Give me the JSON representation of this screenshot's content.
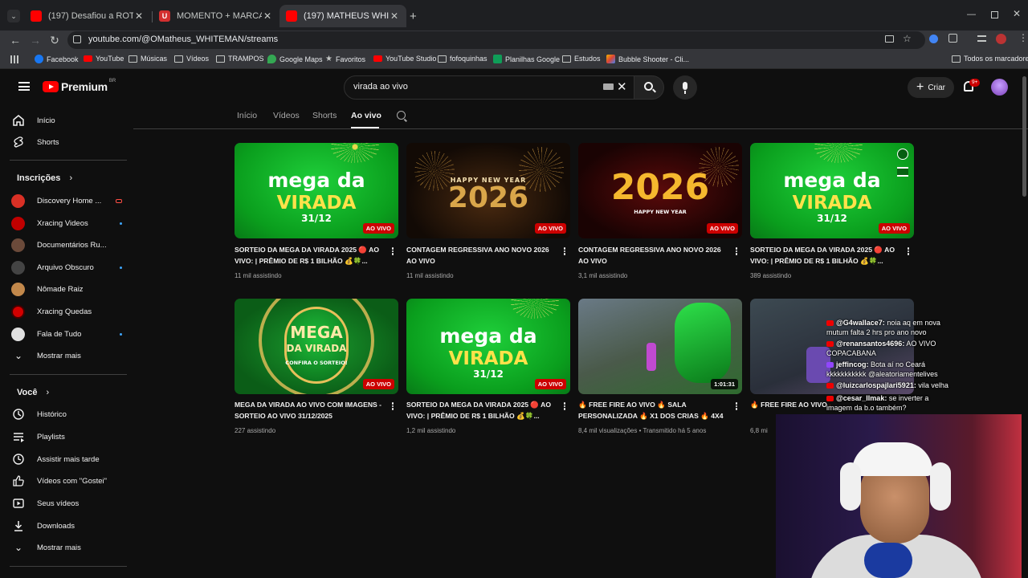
{
  "browser": {
    "tabs": [
      {
        "title": "(197) Desafiou a ROTA do PARÁ",
        "active": false
      },
      {
        "title": "MOMENTO + MARCANTE 2025",
        "active": false
      },
      {
        "title": "(197) MATHEUS WHITEMAN - Yo",
        "active": true
      }
    ],
    "url": "youtube.com/@OMatheus_WHITEMAN/streams",
    "bookmarks": [
      "Facebook",
      "YouTube",
      "Músicas",
      "Vídeos",
      "TRAMPOS",
      "Google Maps",
      "Favoritos",
      "YouTube Studio",
      "fofoquinhas",
      "Planilhas Google",
      "Estudos",
      "Bubble Shooter - Cli..."
    ],
    "all_bookmarks": "Todos os marcadores"
  },
  "header": {
    "logo": "Premium",
    "region": "BR",
    "search_value": "virada ao vivo",
    "create_label": "Criar",
    "notifications": "9+"
  },
  "sidebar": {
    "main": [
      {
        "label": "Início",
        "icon": "home-icon"
      },
      {
        "label": "Shorts",
        "icon": "shorts-icon"
      }
    ],
    "subscriptions_title": "Inscrições",
    "subscriptions": [
      {
        "label": "Discovery Home ...",
        "color": "#d93025",
        "indicator": "live"
      },
      {
        "label": "Xracing Videos",
        "color": "#c00000",
        "indicator": "dot"
      },
      {
        "label": "Documentários Ru...",
        "color": "#6b4a3a",
        "indicator": ""
      },
      {
        "label": "Arquivo Obscuro",
        "color": "#444444",
        "indicator": "dot"
      },
      {
        "label": "Nômade Raiz",
        "color": "#c2884b",
        "indicator": ""
      },
      {
        "label": "Xracing Quedas",
        "color": "#d20000",
        "indicator": ""
      },
      {
        "label": "Fala de Tudo",
        "color": "#e0e0e0",
        "indicator": "dot"
      }
    ],
    "show_more": "Mostrar mais",
    "you_title": "Você",
    "you_items": [
      {
        "label": "Histórico",
        "icon": "history-icon"
      },
      {
        "label": "Playlists",
        "icon": "playlists-icon"
      },
      {
        "label": "Assistir mais tarde",
        "icon": "watch-later-icon"
      },
      {
        "label": "Vídeos com \"Gostei\"",
        "icon": "like-icon"
      },
      {
        "label": "Seus vídeos",
        "icon": "your-videos-icon"
      },
      {
        "label": "Downloads",
        "icon": "download-icon"
      }
    ],
    "show_more_2": "Mostrar mais"
  },
  "channel_tabs": [
    "Início",
    "Vídeos",
    "Shorts",
    "Ao vivo"
  ],
  "videos": [
    {
      "title": "SORTEIO DA MEGA DA VIRADA 2025 🔴 AO VIVO: | PRÊMIO DE R$ 1 BILHÃO 💰🍀...",
      "meta": "11 mil assistindo",
      "badge": "AO VIVO",
      "thumb": "mega"
    },
    {
      "title": "CONTAGEM REGRESSIVA ANO NOVO 2026 AO VIVO",
      "meta": "11 mil assistindo",
      "badge": "AO VIVO",
      "thumb": "hny"
    },
    {
      "title": "CONTAGEM REGRESSIVA ANO NOVO 2026 AO VIVO",
      "meta": "3,1 mil assistindo",
      "badge": "AO VIVO",
      "thumb": "red2026"
    },
    {
      "title": "SORTEIO DA MEGA DA VIRADA 2025 🔴 AO VIVO: | PRÊMIO DE R$ 1 BILHÃO 💰🍀...",
      "meta": "389 assistindo",
      "badge": "AO VIVO",
      "thumb": "mega"
    },
    {
      "title": "MEGA DA VIRADA AO VIVO COM IMAGENS - SORTEIO AO VIVO 31/12/2025",
      "meta": "227 assistindo",
      "badge": "AO VIVO",
      "thumb": "megabadge"
    },
    {
      "title": "SORTEIO DA MEGA DA VIRADA 2025 🔴 AO VIVO: | PRÊMIO DE R$ 1 BILHÃO 💰🍀...",
      "meta": "1,2 mil assistindo",
      "badge": "AO VIVO",
      "thumb": "mega"
    },
    {
      "title": "🔥 FREE FIRE AO VIVO 🔥 SALA PERSONALIZADA 🔥 X1 DOS CRIAS 🔥 4X4",
      "meta": "8,4 mil visualizações • Transmitido há 5 anos",
      "badge": "1:01:31",
      "thumb": "ff"
    },
    {
      "title": "🔥 FREE FIRE AO VIVO 🔥 SALA PERSO...",
      "meta": "6,8 mi",
      "badge": "",
      "thumb": "ff2"
    }
  ],
  "thumb_text": {
    "mega_line1": "mega da",
    "mega_line2": "VIRADA",
    "mega_date": "31/12",
    "hny": "HAPPY NEW YEAR",
    "year": "2026",
    "hny2": "HAPPY NEW YEAR",
    "badge_mega": "MEGA",
    "badge_virada": "DA VIRADA",
    "badge_confira": "CONFIRA O SORTEIO!"
  },
  "chat": [
    {
      "user": "@G4wallace7:",
      "text": "noia aq em nova"
    },
    {
      "user": "",
      "text": "mutum falta 2 hrs pro ano novo"
    },
    {
      "user": "@renansantos4696:",
      "text": "AO VIVO"
    },
    {
      "user": "",
      "text": "COPACABANA"
    },
    {
      "user": "jeffincog:",
      "text": "Bota aí no Ceará"
    },
    {
      "user": "",
      "text": "kkkkkkkkkkk @aleatoriamentelives"
    },
    {
      "user": "@luizcarlospajlari5921:",
      "text": "vila velha"
    },
    {
      "user": "@cesar_llmak:",
      "text": "se inverter a"
    },
    {
      "user": "",
      "text": "imagem da b.o também?"
    }
  ],
  "colors": {
    "accent": "#ff0000",
    "live_badge": "#cc0000",
    "link": "#3ea6ff"
  }
}
